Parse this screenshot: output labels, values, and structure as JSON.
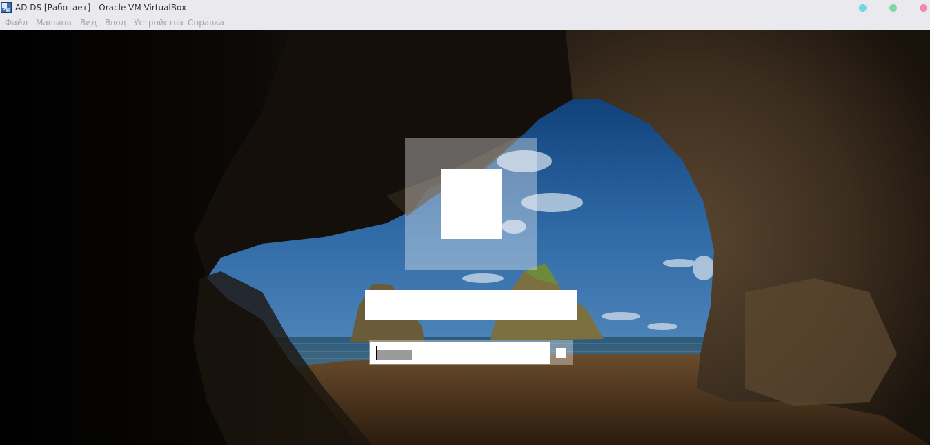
{
  "window": {
    "title": "AD DS [Работает] - Oracle VM VirtualBox",
    "app_icon": "virtualbox-icon",
    "controls": [
      {
        "name": "minimize",
        "color": "#6fd6e6"
      },
      {
        "name": "maximize",
        "color": "#7dd8b0"
      },
      {
        "name": "close",
        "color": "#f08aa8"
      }
    ]
  },
  "menu": {
    "items": [
      {
        "label": "Файл"
      },
      {
        "label": "Машина"
      },
      {
        "label": "Вид"
      },
      {
        "label": "Ввод"
      },
      {
        "label": "Устройства"
      },
      {
        "label": "Справка"
      }
    ]
  },
  "login": {
    "password_value": "",
    "submit_icon": "arrow-right-icon"
  },
  "colors": {
    "chrome_bg": "#eaeaee",
    "menu_text": "#a3a3a8",
    "title_text": "#333333"
  }
}
